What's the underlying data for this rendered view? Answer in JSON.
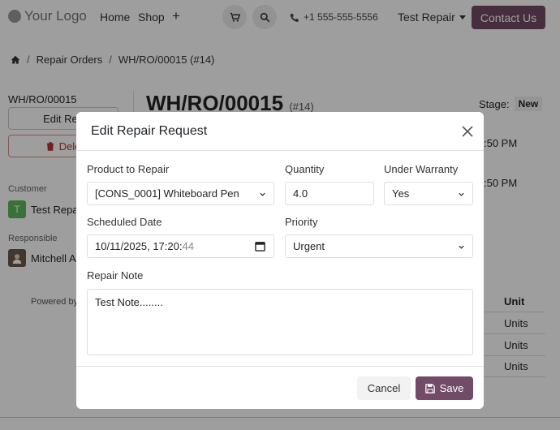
{
  "navbar": {
    "logo_text": "Your Logo",
    "home_label": "Home",
    "shop_label": "Shop",
    "plus_label": "+",
    "phone": "+1 555-555-5556",
    "user_name": "Test Repair",
    "contact_label": "Contact Us"
  },
  "breadcrumb": {
    "items": [
      "Repair Orders",
      "WH/RO/00015 (#14)"
    ]
  },
  "sidebar": {
    "reference": "WH/RO/00015",
    "edit_label": "Edit Req",
    "delete_label": "Dele",
    "customer_label": "Customer",
    "customer_initial": "T",
    "customer_name": "Test Repa",
    "responsible_label": "Responsible",
    "responsible_name": "Mitchell A",
    "powered_by": "Powered by"
  },
  "main": {
    "title": "WH/RO/00015",
    "title_suffix": "(#14)",
    "stage_label": "Stage:",
    "stage_value": "New",
    "time_frag_1": ":50 PM",
    "time_frag_2": ":50 PM",
    "unit_header": "Unit",
    "unit_rows": [
      "Units",
      "Units",
      "Units"
    ]
  },
  "modal": {
    "title": "Edit Repair Request",
    "product_label": "Product to Repair",
    "product_value": "[CONS_0001] Whiteboard Pen",
    "quantity_label": "Quantity",
    "quantity_value": "4.0",
    "warranty_label": "Under Warranty",
    "warranty_value": "Yes",
    "date_label": "Scheduled Date",
    "date_value": "10/11/2025, 17:20:",
    "date_seconds": "44",
    "priority_label": "Priority",
    "priority_value": "Urgent",
    "note_label": "Repair Note",
    "note_value": "Test Note........",
    "cancel_label": "Cancel",
    "save_label": "Save"
  },
  "colors": {
    "accent": "#714b67",
    "overlay": "rgba(0,0,0,0.38)"
  },
  "icons": {
    "cart": "cart-icon",
    "search": "search-icon",
    "phone": "phone-icon",
    "home": "home-icon",
    "close": "close-icon",
    "save": "save-icon",
    "calendar": "calendar-icon",
    "trash": "trash-icon"
  }
}
